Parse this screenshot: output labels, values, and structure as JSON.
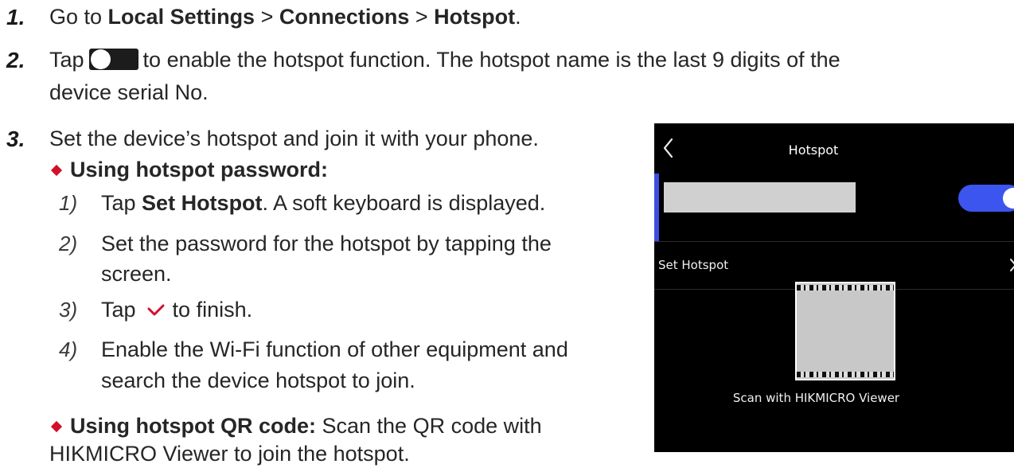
{
  "step1": {
    "num": "1.",
    "pre": "Go to ",
    "settings": "Local Settings",
    "sep1": " > ",
    "connections": "Connections",
    "sep2": " > ",
    "hotspot": "Hotspot",
    "end": "."
  },
  "step2": {
    "num": "2.",
    "pre": "Tap",
    "text": "to enable the hotspot function. The hotspot name is the last 9 digits of the",
    "text2": "device serial No."
  },
  "step3": {
    "num": "3.",
    "text": "Set the device’s hotspot and join it with your phone."
  },
  "password": {
    "label": "Using hotspot password:",
    "s1_num": "1)",
    "s1_pre": "Tap ",
    "s1_bold": "Set Hotspot",
    "s1_post": ". A soft keyboard is displayed.",
    "s2_num": "2)",
    "s2_text": "Set the password for the hotspot by tapping the",
    "s2_text2": "screen.",
    "s3_num": "3)",
    "s3_pre": "Tap",
    "s3_post": "to finish.",
    "s4_num": "4)",
    "s4_text": "Enable the Wi-Fi function of other equipment and",
    "s4_text2": "search the device hotspot to join."
  },
  "qr": {
    "label": "Using hotspot QR code:",
    "text": " Scan the QR code with",
    "text2": "HIKMICRO Viewer to join the hotspot."
  },
  "phone": {
    "title": "Hotspot",
    "set_hotspot": "Set Hotspot",
    "scan": "Scan with HIKMICRO Viewer",
    "toggle_state": "on",
    "accent_color": "#3c55ef"
  },
  "colors": {
    "bullet": "#d0102a",
    "check": "#d0102a"
  }
}
